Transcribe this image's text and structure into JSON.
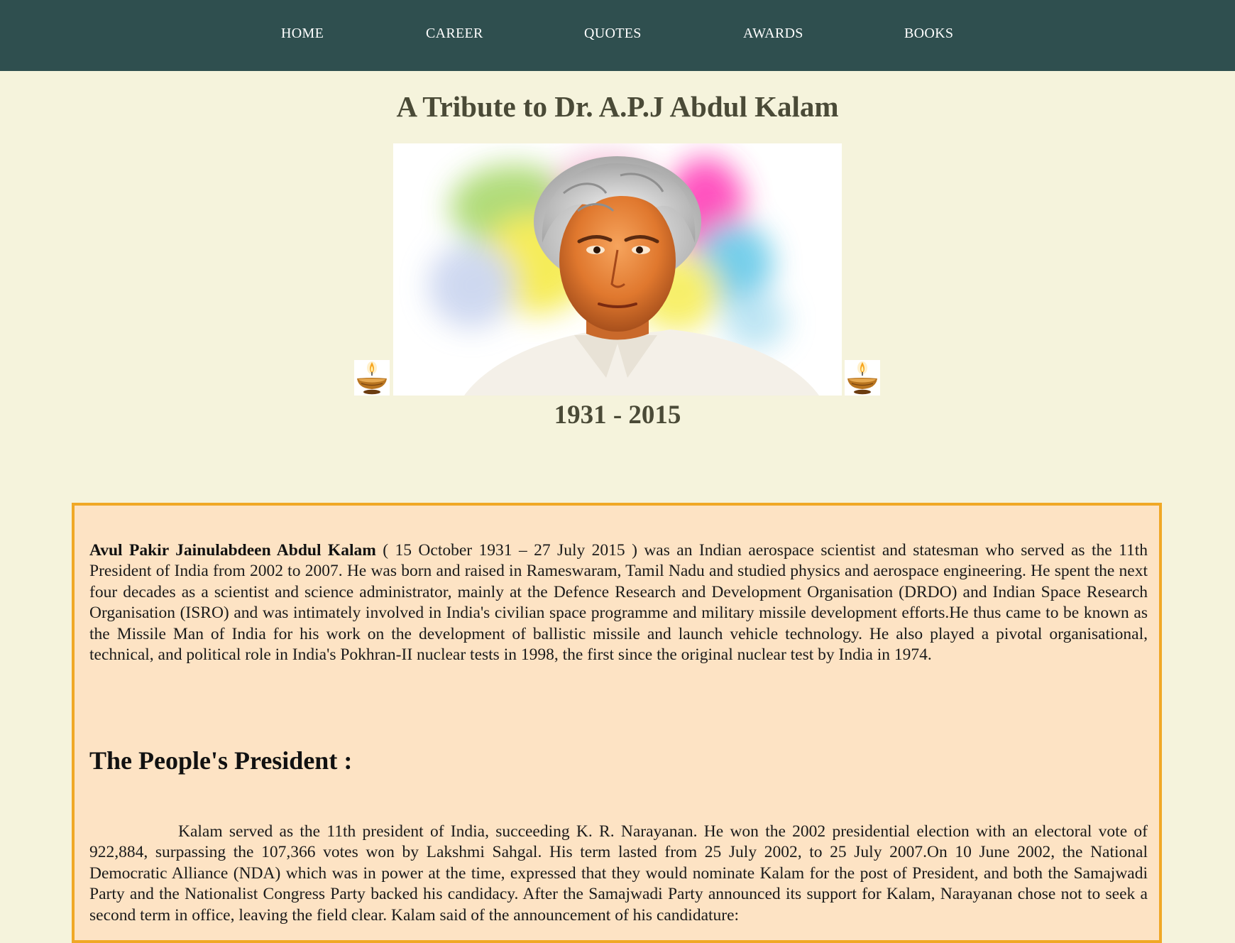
{
  "nav": {
    "items": [
      {
        "label": "HOME"
      },
      {
        "label": "CAREER"
      },
      {
        "label": "QUOTES"
      },
      {
        "label": "AWARDS"
      },
      {
        "label": "BOOKS"
      }
    ]
  },
  "header": {
    "title": "A Tribute to Dr. A.P.J Abdul Kalam",
    "years": "1931 - 2015"
  },
  "icons": {
    "portrait": "portrait-image",
    "lamp_left": "diya-lamp-icon",
    "lamp_right": "diya-lamp-icon"
  },
  "bio": {
    "name": "Avul Pakir Jainulabdeen Abdul Kalam",
    "text": " ( 15 October 1931 – 27 July 2015 ) was an Indian aerospace scientist and statesman who served as the 11th President of India from 2002 to 2007. He was born and raised in Rameswaram, Tamil Nadu and studied physics and aerospace engineering. He spent the next four decades as a scientist and science administrator, mainly at the Defence Research and Development Organisation (DRDO) and Indian Space Research Organisation (ISRO) and was intimately involved in India's civilian space programme and military missile development efforts.He thus came to be known as the Missile Man of India for his work on the development of ballistic missile and launch vehicle technology. He also played a pivotal organisational, technical, and political role in India's Pokhran-II nuclear tests in 1998, the first since the original nuclear test by India in 1974."
  },
  "president_section": {
    "heading": "The People's President :",
    "text": "Kalam served as the 11th president of India, succeeding K. R. Narayanan. He won the 2002 presidential election with an electoral vote of 922,884, surpassing the 107,366 votes won by Lakshmi Sahgal. His term lasted from 25 July 2002, to 25 July 2007.On 10 June 2002, the National Democratic Alliance (NDA) which was in power at the time, expressed that they would nominate Kalam for the post of President, and both the Samajwadi Party and the Nationalist Congress Party backed his candidacy. After the Samajwadi Party announced its support for Kalam, Narayanan chose not to seek a second term in office, leaving the field clear. Kalam said of the announcement of his candidature:"
  },
  "colors": {
    "nav_bg": "#2f4f4f",
    "page_bg": "#f5f3dc",
    "box_bg": "#fde3c4",
    "box_border": "#f0a826",
    "heading": "#4a4a37"
  }
}
